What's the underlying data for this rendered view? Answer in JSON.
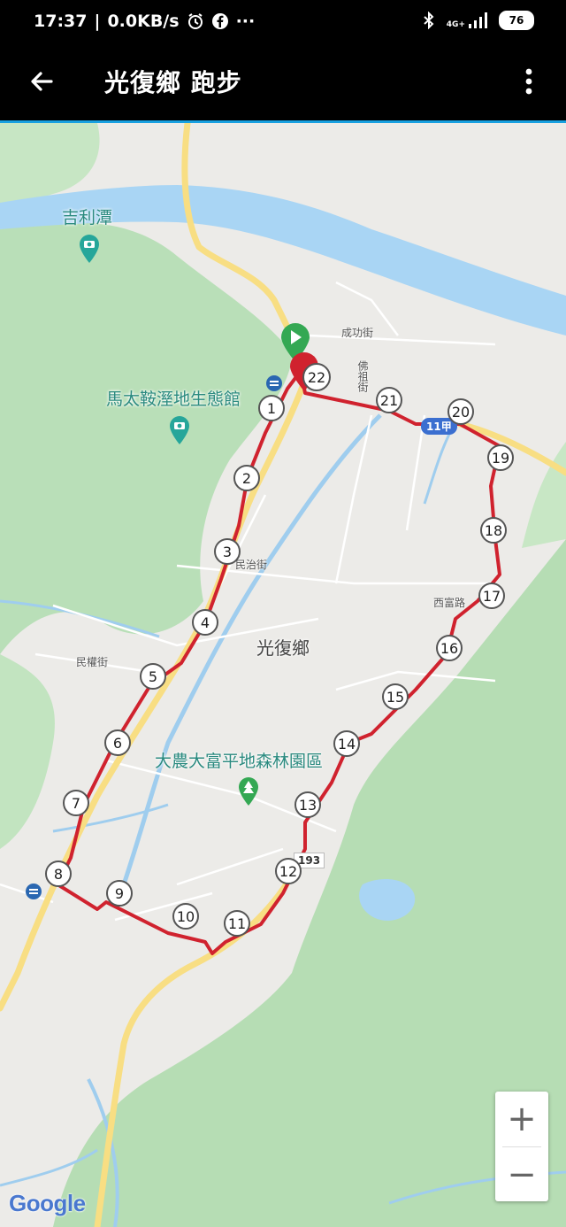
{
  "status_bar": {
    "time": "17:37",
    "net_speed": "0.0KB/s",
    "more": "···",
    "network": "4G+",
    "battery": "76"
  },
  "header": {
    "title": "光復鄉 跑步"
  },
  "map": {
    "labels": {
      "poi_jililan": "吉利潭",
      "poi_wetland": "馬太鞍溼地生態館",
      "poi_forest": "大農大富平地森林園區",
      "town": "光復鄉"
    },
    "roads": {
      "chenggong": "成功街",
      "foshu": "佛祖街",
      "minzhi": "民治街",
      "xifu": "西富路",
      "minyao": "民權街",
      "route11": "11甲",
      "route193": "193"
    },
    "start_marker": "start-flag",
    "end_marker": "finish-pin",
    "end_label": "22",
    "km_markers": [
      "1",
      "2",
      "3",
      "4",
      "5",
      "6",
      "7",
      "8",
      "9",
      "10",
      "11",
      "12",
      "13",
      "14",
      "15",
      "16",
      "17",
      "18",
      "19",
      "20",
      "21"
    ],
    "colors": {
      "route": "#d0222e",
      "river": "#a8d4f2",
      "forest": "#b7deb7",
      "land": "#ecebe8",
      "major_road": "#f9e07e",
      "start": "#34a853"
    }
  },
  "zoom": {
    "in": "+",
    "out": "−"
  },
  "attribution": "Google"
}
